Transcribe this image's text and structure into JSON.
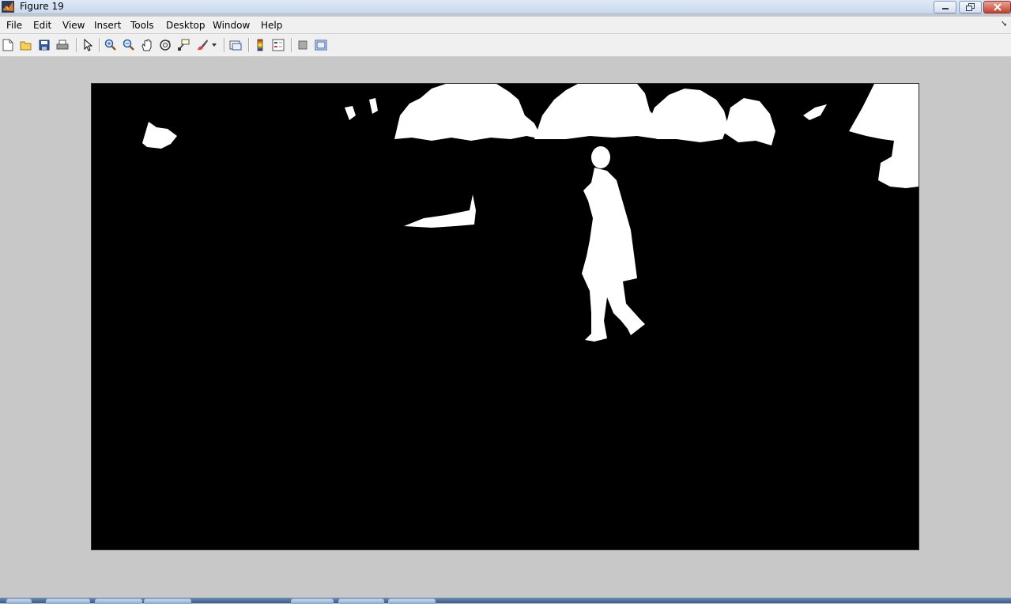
{
  "window": {
    "title": "Figure 19"
  },
  "menu": {
    "file": "File",
    "edit": "Edit",
    "view": "View",
    "insert": "Insert",
    "tools": "Tools",
    "desktop": "Desktop",
    "window": "Window",
    "help": "Help"
  },
  "toolbar_icons": [
    "new-figure-icon",
    "open-file-icon",
    "save-icon",
    "print-icon",
    "edit-plot-arrow-icon",
    "zoom-in-icon",
    "zoom-out-icon",
    "pan-hand-icon",
    "rotate-3d-icon",
    "data-cursor-icon",
    "brush-icon",
    "brush-dropdown-icon",
    "link-plot-icon",
    "insert-colorbar-icon",
    "insert-legend-icon",
    "hide-plot-tools-icon",
    "show-plot-tools-icon"
  ],
  "figure": {
    "content": "binary segmentation image",
    "colors": {
      "background": "#000000",
      "foreground": "#ffffff"
    }
  },
  "colors": {
    "window_bg": "#c8c8c8",
    "close_button": "#c4412d"
  }
}
